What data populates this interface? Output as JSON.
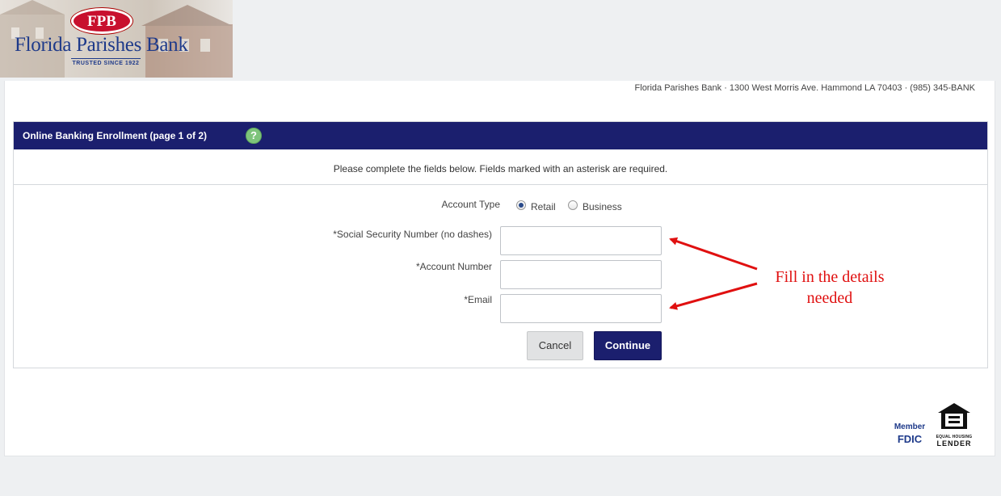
{
  "bank": {
    "logo_abbrev": "FPB",
    "name": "Florida Parishes Bank",
    "tagline": "TRUSTED SINCE 1922",
    "address_line": "Florida Parishes Bank · 1300 West Morris Ave. Hammond LA 70403 · (985) 345-BANK"
  },
  "enrollment": {
    "title": "Online Banking Enrollment (page 1 of 2)",
    "help_icon": "question-icon",
    "instructions": "Please complete the fields below. Fields marked with an asterisk are required.",
    "account_type_label": "Account Type",
    "account_type_options": [
      {
        "label": "Retail",
        "selected": true
      },
      {
        "label": "Business",
        "selected": false
      }
    ],
    "fields": {
      "ssn_label": "*Social Security Number (no dashes)",
      "ssn_value": "",
      "account_number_label": "*Account Number",
      "account_number_value": "",
      "email_label": "*Email",
      "email_value": ""
    },
    "cancel_label": "Cancel",
    "continue_label": "Continue"
  },
  "footer": {
    "fdic_member": "Member",
    "fdic": "FDIC",
    "ehl_top": "EQUAL HOUSING",
    "ehl_bottom": "LENDER"
  },
  "annotation": {
    "line1": "Fill in the details",
    "line2": "needed"
  },
  "colors": {
    "header_navy": "#1b1f6e",
    "logo_red": "#c8102e",
    "brand_blue": "#1e3a8a",
    "annotation_red": "#e01010",
    "help_green": "#7ec47b"
  }
}
